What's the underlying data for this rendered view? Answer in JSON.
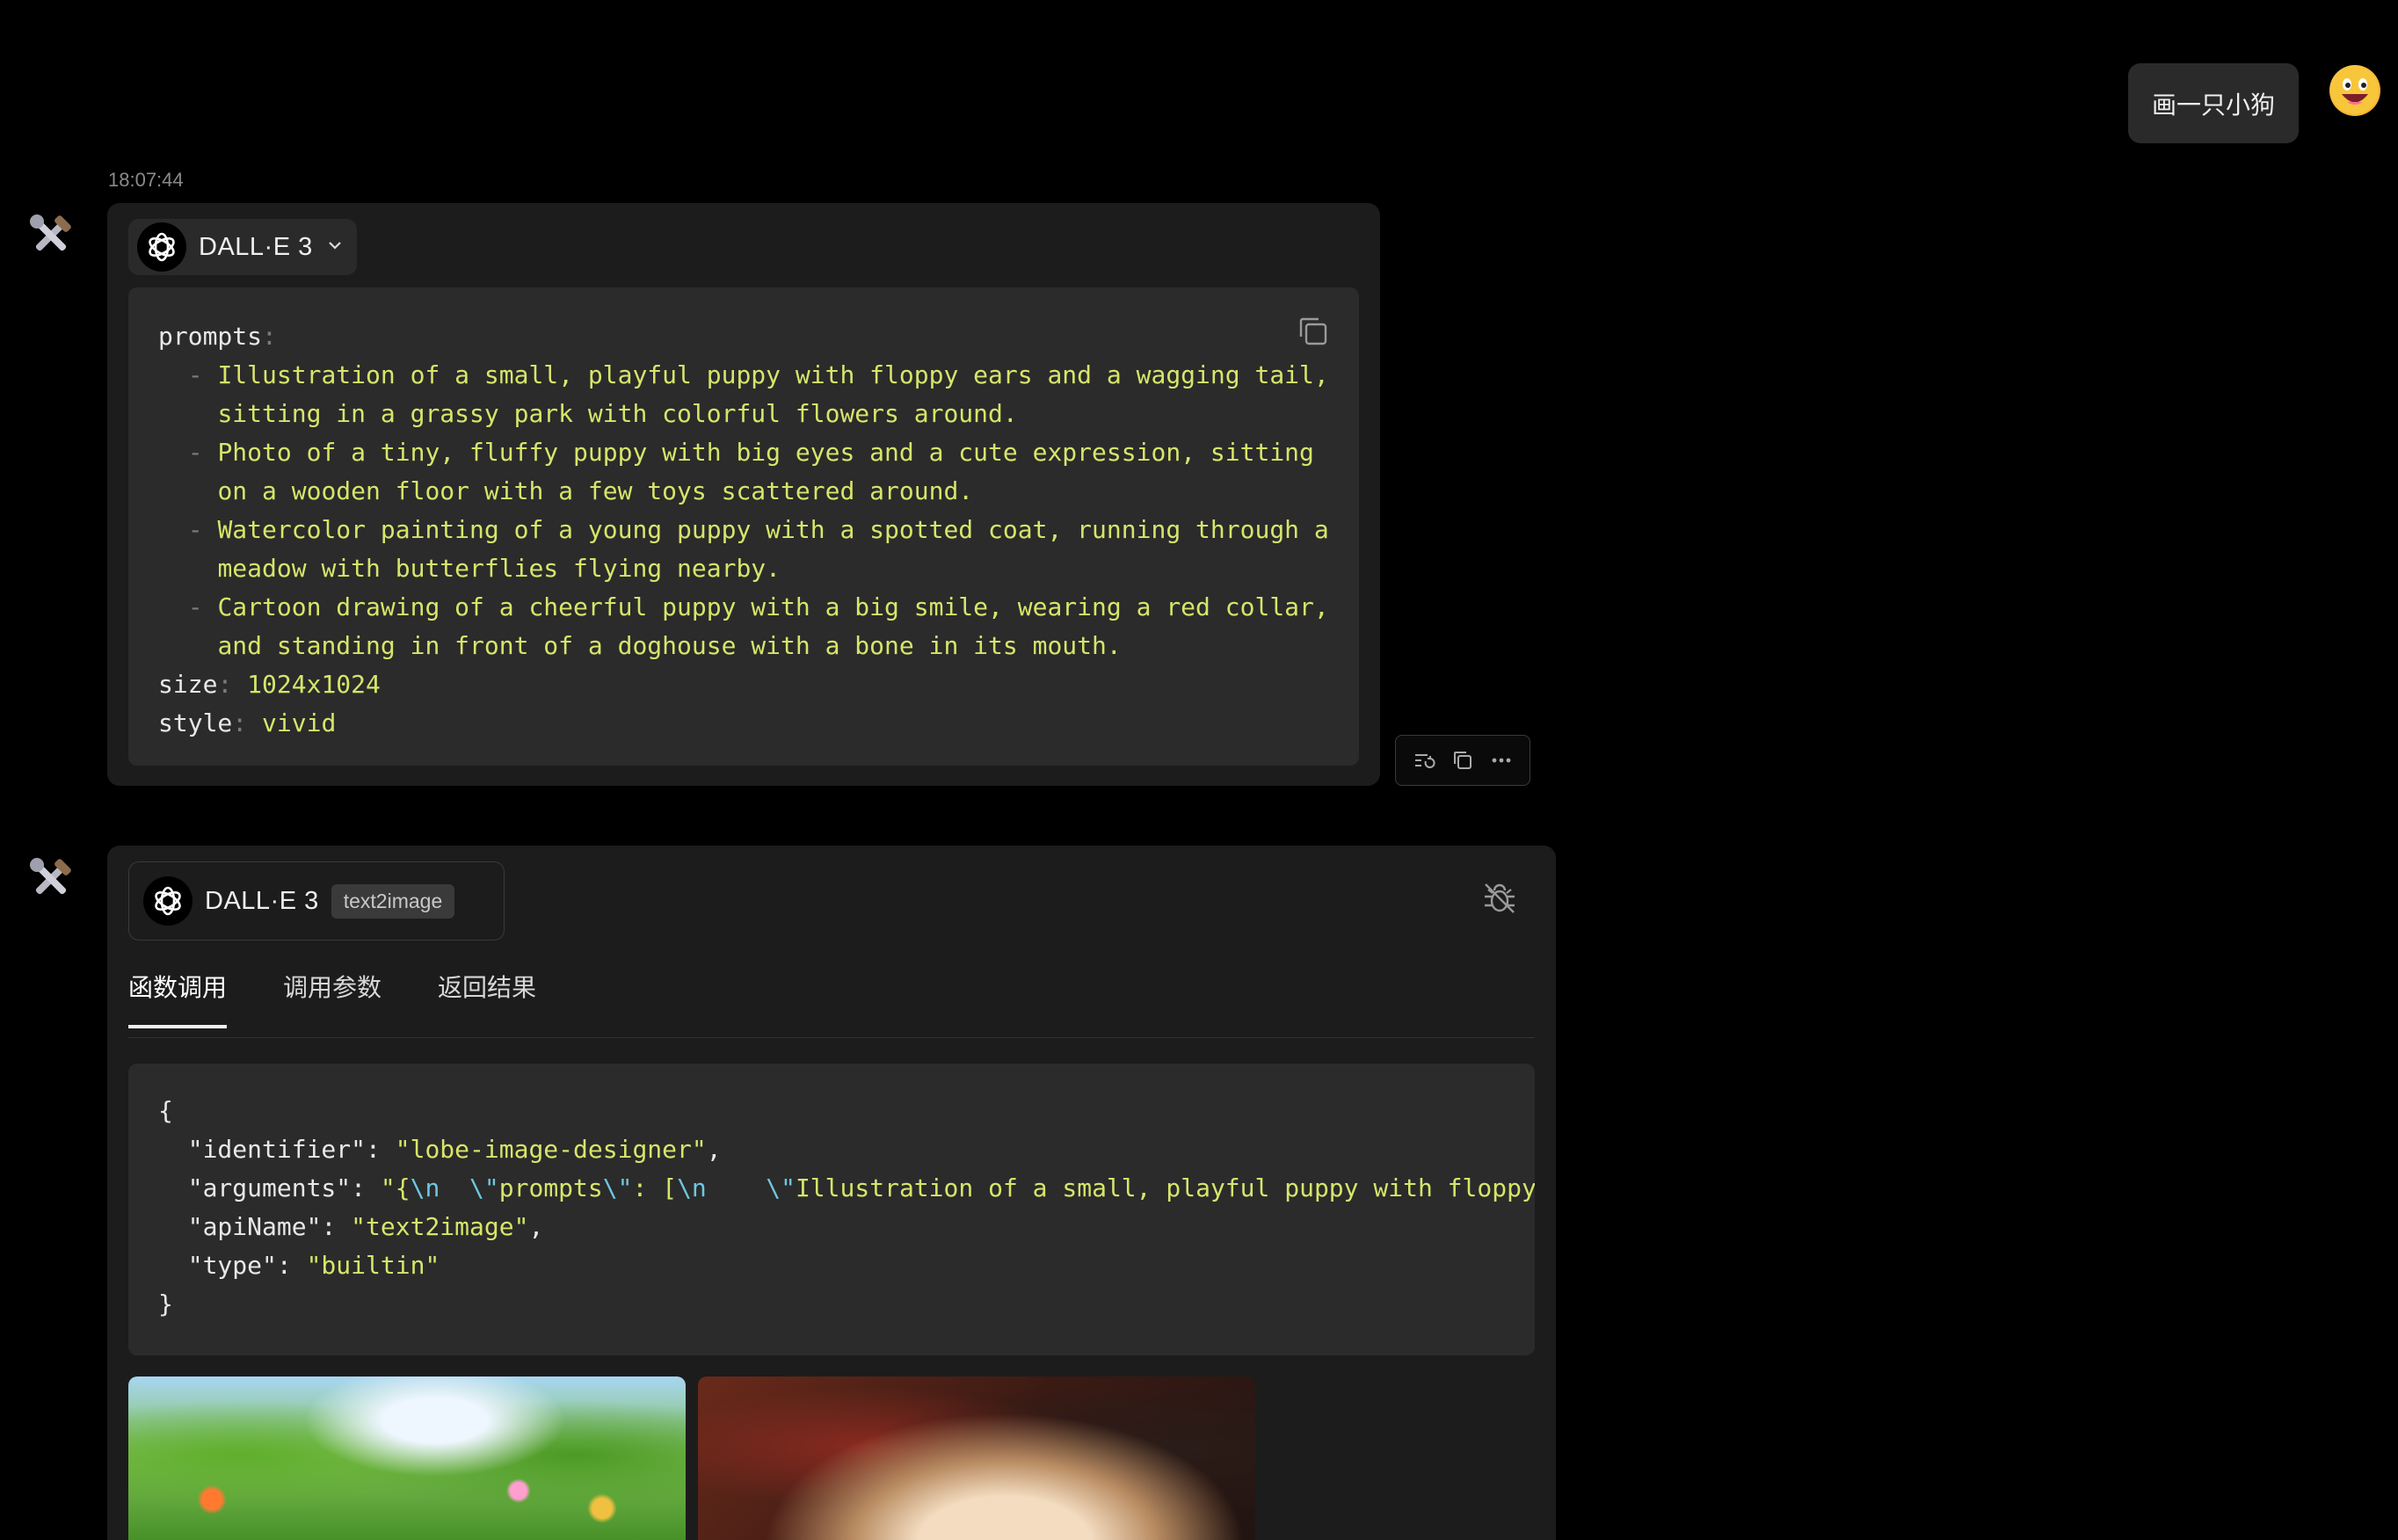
{
  "user_message": {
    "text": "画一只小狗"
  },
  "assistant_message": {
    "timestamp": "18:07:44",
    "plugin_name": "DALL·E 3",
    "code_lines": [
      [
        [
          "prompts",
          "k"
        ],
        [
          ":",
          "p"
        ]
      ],
      [
        [
          "  - ",
          "p"
        ],
        [
          "Illustration of a small, playful puppy with floppy ears and a wagging tail,",
          "s"
        ]
      ],
      [
        [
          "    ",
          "p"
        ],
        [
          "sitting in a grassy park with colorful flowers around.",
          "s"
        ]
      ],
      [
        [
          "  - ",
          "p"
        ],
        [
          "Photo of a tiny, fluffy puppy with big eyes and a cute expression, sitting",
          "s"
        ]
      ],
      [
        [
          "    ",
          "p"
        ],
        [
          "on a wooden floor with a few toys scattered around.",
          "s"
        ]
      ],
      [
        [
          "  - ",
          "p"
        ],
        [
          "Watercolor painting of a young puppy with a spotted coat, running through a",
          "s"
        ]
      ],
      [
        [
          "    ",
          "p"
        ],
        [
          "meadow with butterflies flying nearby.",
          "s"
        ]
      ],
      [
        [
          "  - ",
          "p"
        ],
        [
          "Cartoon drawing of a cheerful puppy with a big smile, wearing a red collar,",
          "s"
        ]
      ],
      [
        [
          "    ",
          "p"
        ],
        [
          "and standing in front of a doghouse with a bone in its mouth.",
          "s"
        ]
      ],
      [
        [
          "size",
          "k"
        ],
        [
          ": ",
          "p"
        ],
        [
          "1024x1024",
          "s"
        ]
      ],
      [
        [
          "style",
          "k"
        ],
        [
          ": ",
          "p"
        ],
        [
          "vivid",
          "s"
        ]
      ]
    ]
  },
  "tool_message": {
    "plugin_name": "DALL·E 3",
    "api_tag": "text2image",
    "tabs": [
      "函数调用",
      "调用参数",
      "返回结果"
    ],
    "active_tab": 0,
    "code_lines": [
      [
        [
          "{",
          "k"
        ]
      ],
      [
        [
          "  \"identifier\"",
          "k"
        ],
        [
          ": ",
          "k"
        ],
        [
          "\"lobe-image-designer\"",
          "s"
        ],
        [
          ",",
          "k"
        ]
      ],
      [
        [
          "  \"arguments\"",
          "k"
        ],
        [
          ": ",
          "k"
        ],
        [
          "\"{",
          "s"
        ],
        [
          "\\n",
          "esc"
        ],
        [
          "  ",
          "s"
        ],
        [
          "\\\"",
          "esc"
        ],
        [
          "prompts",
          "s"
        ],
        [
          "\\\"",
          "esc"
        ],
        [
          ": [",
          "s"
        ],
        [
          "\\n",
          "esc"
        ],
        [
          "    ",
          "s"
        ],
        [
          "\\\"",
          "esc"
        ],
        [
          "Illustration of a small, playful puppy with floppy",
          "s"
        ]
      ],
      [
        [
          "  \"apiName\"",
          "k"
        ],
        [
          ": ",
          "k"
        ],
        [
          "\"text2image\"",
          "s"
        ],
        [
          ",",
          "k"
        ]
      ],
      [
        [
          "  \"type\"",
          "k"
        ],
        [
          ": ",
          "k"
        ],
        [
          "\"builtin\"",
          "s"
        ]
      ],
      [
        [
          "}",
          "k"
        ]
      ]
    ]
  },
  "colors": {
    "background": "#000000",
    "card": "#1c1c1c",
    "code_bg": "#2b2b2b",
    "string": "#d7e56a",
    "escape": "#6fc7e0"
  },
  "icons": [
    "tool-avatar-icon",
    "openai-logo-icon",
    "chevron-down-icon",
    "copy-icon",
    "regenerate-icon",
    "more-icon",
    "debug-off-icon",
    "user-emoji-avatar"
  ]
}
